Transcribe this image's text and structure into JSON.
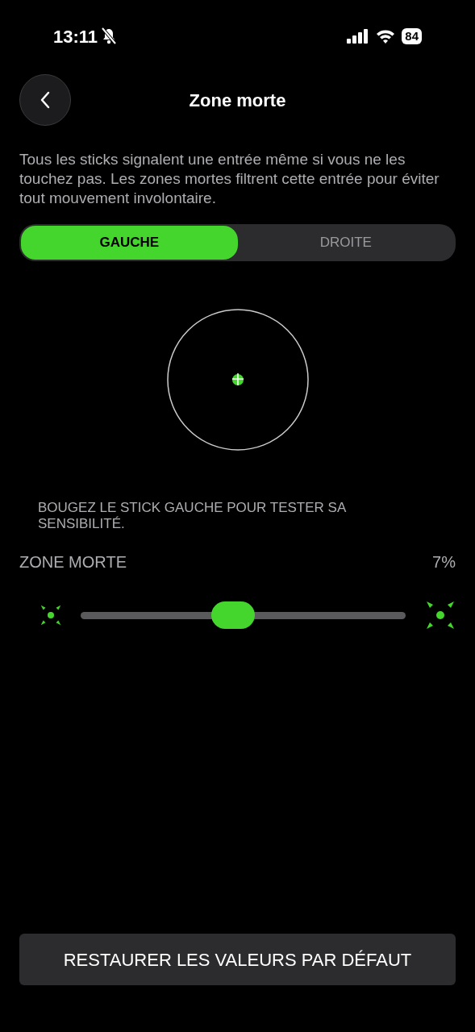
{
  "status_bar": {
    "time": "13:11",
    "battery": "84"
  },
  "header": {
    "title": "Zone morte"
  },
  "description": "Tous les sticks signalent une entrée même si vous ne les touchez pas. Les zones mortes filtrent cette entrée pour éviter tout mouvement involontaire.",
  "tabs": [
    {
      "label": "GAUCHE",
      "selected": true
    },
    {
      "label": "DROITE",
      "selected": false
    }
  ],
  "hint": "BOUGEZ LE STICK GAUCHE POUR TESTER SA SENSIBILITÉ.",
  "deadzone": {
    "label": "ZONE MORTE",
    "reading": "7%",
    "level": 0.47
  },
  "reset_button": "RESTAURER LES VALEURS PAR DÉFAUT"
}
